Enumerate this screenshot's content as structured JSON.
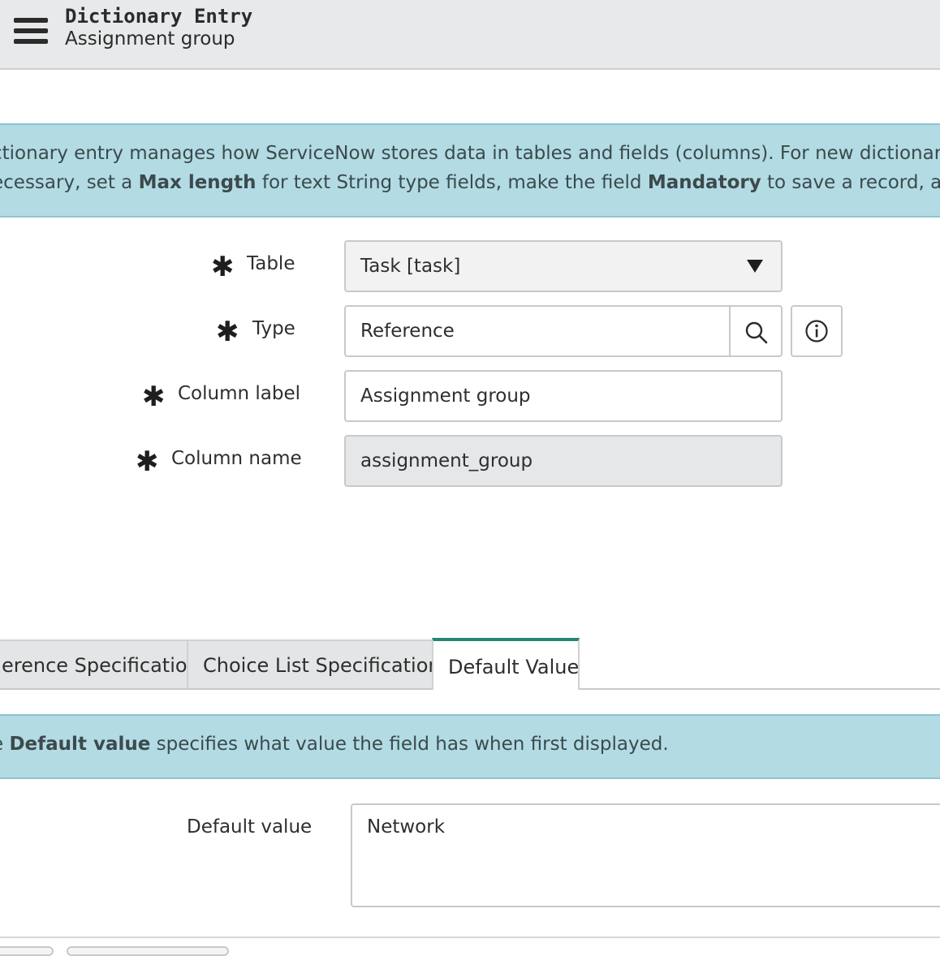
{
  "header": {
    "title": "Dictionary Entry",
    "subtitle": "Assignment group",
    "menu_icon": "hamburger-menu-icon"
  },
  "info_banner": {
    "line1": "ctionary entry manages how ServiceNow stores data in tables and fields (columns). For new dictionary entri",
    "line2_a": "ecessary, set a ",
    "line2_b": "Max length",
    "line2_c": " for text String type fields, make the field ",
    "line2_d": "Mandatory",
    "line2_e": " to save a record, and make"
  },
  "form": {
    "required_icon": "asterisk-required-icon",
    "table": {
      "label": "Table",
      "value": "Task [task]"
    },
    "type": {
      "label": "Type",
      "value": "Reference",
      "lookup_icon": "search-icon",
      "info_icon": "info-icon"
    },
    "column_label": {
      "label": "Column label",
      "value": "Assignment group"
    },
    "column_name": {
      "label": "Column name",
      "value": "assignment_group"
    }
  },
  "tabs": [
    {
      "label": "erence Specification",
      "active": false
    },
    {
      "label": "Choice List Specification",
      "active": false
    },
    {
      "label": "Default Value",
      "active": true
    }
  ],
  "default_banner": {
    "a": "e ",
    "b": "Default value",
    "c": " specifies what value the field has when first displayed."
  },
  "default_value": {
    "label": "Default value",
    "value": "Network"
  },
  "colors": {
    "header_bg": "#e8e9ea",
    "banner_bg": "#b3dbe3",
    "active_tab_accent": "#278576"
  }
}
